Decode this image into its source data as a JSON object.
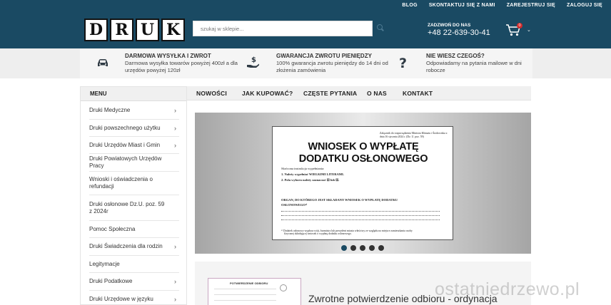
{
  "header": {
    "top_links": [
      "BLOG",
      "SKONTAKTUJ SIĘ Z NAMI",
      "ZAREJESTRUJ SIĘ",
      "ZALOGUJ SIĘ"
    ],
    "logo_letters": [
      "D",
      "R",
      "U",
      "K"
    ],
    "search": {
      "placeholder": "szukaj w sklepie..."
    },
    "phone_label": "ZADZWOŃ DO NAS",
    "phone_number": "+48 22-639-30-41",
    "cart_count": "0"
  },
  "features": [
    {
      "icon": "car-icon",
      "title": "DARMOWA WYSYŁKA I ZWROT",
      "desc": "Darmowa wysyłka towarów powyżej 400zł a dla urzędów powyżej 120zł"
    },
    {
      "icon": "money-hand-icon",
      "title": "GWARANCJA ZWROTU PIENIĘDZY",
      "desc": "100% gwarancja zwrotu pieniędzy do 14 dni od złożenia zamówienia"
    },
    {
      "icon": "question-icon",
      "title": "NIE WIESZ CZEGOŚ?",
      "desc": "Odpowiadamy na pytania mailowe w dni robocze"
    }
  ],
  "sidebar": {
    "title": "MENU",
    "items": [
      {
        "label": "Druki Medyczne",
        "chevron": "›"
      },
      {
        "label": "Druki powszechnego użytku",
        "chevron": "›"
      },
      {
        "label": "Druki Urzędów Miast i Gmin",
        "chevron": "›"
      },
      {
        "label": "Druki Powiatowych Urzędów Pracy",
        "chevron": ""
      },
      {
        "label": "Wnioski i oświadczenia o refundacji",
        "chevron": ""
      },
      {
        "label": "Druki osłonowe Dz.U. poz. 59 z 2024r",
        "chevron": ""
      },
      {
        "label": "Pomoc Społeczna",
        "chevron": ""
      },
      {
        "label": "Druki Świadczenia dla rodzin",
        "chevron": "›"
      },
      {
        "label": "Legitymacje",
        "chevron": ""
      },
      {
        "label": "Druki Podatkowe",
        "chevron": "›"
      },
      {
        "label": "Druki Urzędowe w języku",
        "chevron": "›"
      }
    ]
  },
  "nav": [
    "NOWOŚCI",
    "JAK KUPOWAĆ?",
    "CZĘSTE PYTANIA",
    "O NAS",
    "KONTAKT"
  ],
  "slider": {
    "doc_header": "Załącznik do rozporządzenia Ministra Klimatu i Środowiska z dnia 16 stycznia 2024 r. (Dz. U. poz. 59)",
    "doc_title_line1": "WNIOSEK O WYPŁATĘ",
    "doc_title_line2": "DODATKU OSŁONOWEGO",
    "doc_instr_head": "Skrócona instrukcja wypełniania:",
    "doc_instr_1": "1.   Należy wypełniać WIELKIMI LITERAMI.",
    "doc_instr_2": "2.   Pola wyboru należy zaznaczać ☒ lub ☒.",
    "doc_section_1": "ORGAN, DO KTÓREGO JEST SKŁADANY WNIOSEK O WYPŁATĘ DODATKU",
    "doc_section_2": "OSŁONOWEGO¹⁾",
    "doc_footnote_1": "¹⁾ Dodatek osłonowy wypłaca wójt, burmistrz lub prezydent miasta właściwy ze względu na miejsce zamieszkania osoby",
    "doc_footnote_2": "fizycznej składającej wniosek o wypłatę dodatku osłonowego.",
    "slide_count": 5,
    "active_slide": 0
  },
  "product": {
    "thumb_title": "POTWIERDZENIE ODBIORU",
    "title": "Zwrotne potwierdzenie odbioru - ordynacja"
  },
  "watermark": "ostatniedrzewo.pl"
}
